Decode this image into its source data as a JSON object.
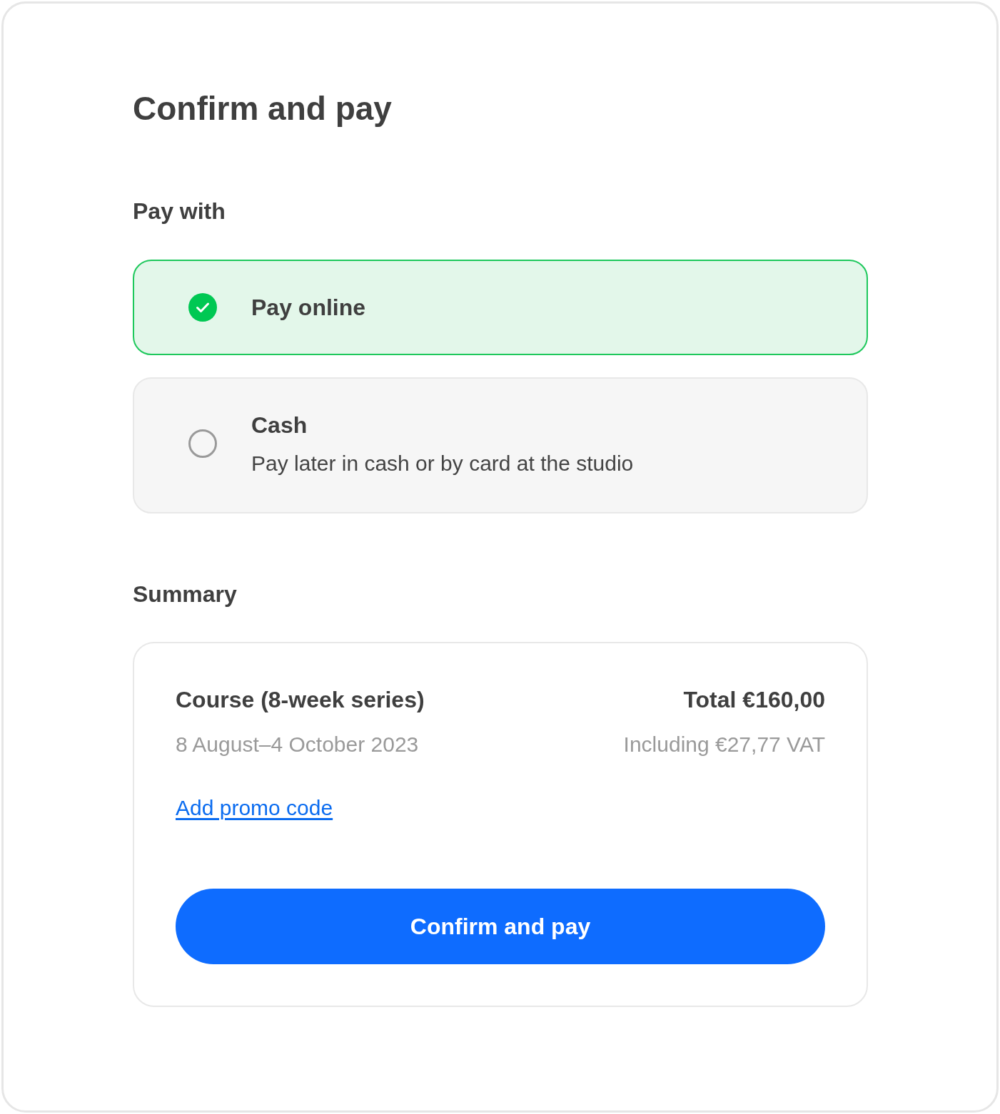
{
  "title": "Confirm and pay",
  "payment": {
    "heading": "Pay with",
    "options": [
      {
        "label": "Pay online",
        "selected": true
      },
      {
        "label": "Cash",
        "description": "Pay later in cash or by card at the studio",
        "selected": false
      }
    ]
  },
  "summary": {
    "heading": "Summary",
    "item": "Course (8-week series)",
    "dates": "8 August–4 October 2023",
    "total": "Total €160,00",
    "vat": "Including €27,77 VAT",
    "promo_link": "Add promo code",
    "button": "Confirm and pay"
  }
}
